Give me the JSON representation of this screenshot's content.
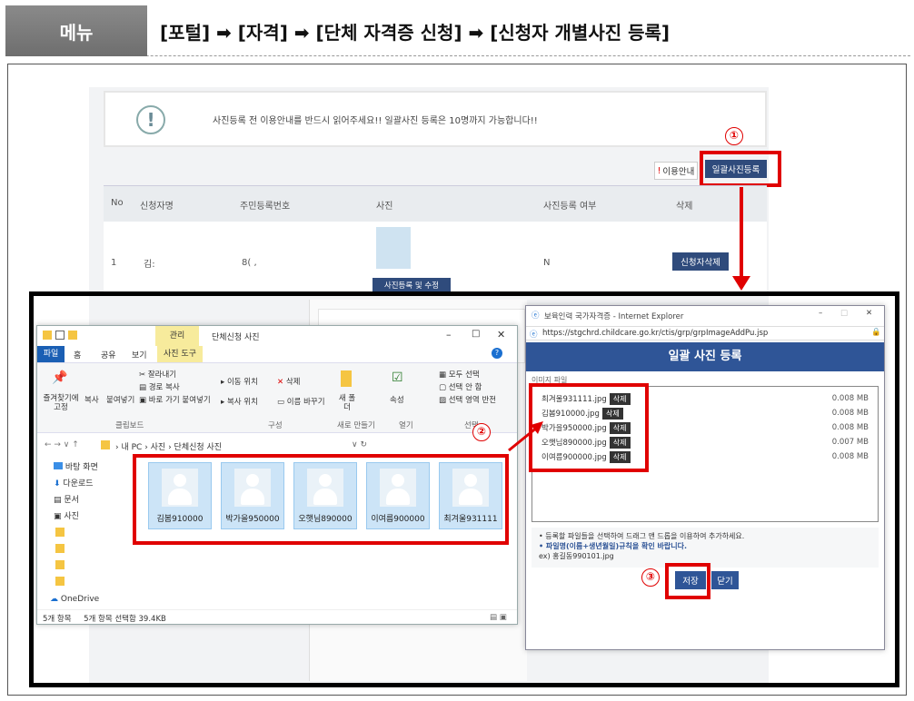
{
  "header": {
    "menu_label": "메뉴",
    "breadcrumb": "[포털] ➡ [자격] ➡ [단체 자격증 신청] ➡ [신청자 개별사진 등록]"
  },
  "webpage": {
    "notice_icon": "exclamation-icon",
    "notice_text": "사진등록 전 이용안내를 반드시 읽어주세요!! 일괄사진 등록은 10명까지 가능합니다!!",
    "guide_button": "이용안내",
    "bulk_upload_button": "일괄사진등록",
    "table": {
      "headers": [
        "No",
        "신청자명",
        "주민등록번호",
        "사진",
        "사진등록 여부",
        "삭제"
      ],
      "rows": [
        {
          "no": "1",
          "name": "김:",
          "rrn": "8(  ,",
          "photo_button": "사진등록 및 수정",
          "registered": "N",
          "delete_button": "신청자삭제"
        }
      ]
    }
  },
  "markers": {
    "step1": "①",
    "step2": "②",
    "step3": "③"
  },
  "explorer": {
    "quick_access_label": "관리",
    "window_title": "단체신청 사진",
    "tabs": [
      "파일",
      "홈",
      "공유",
      "보기",
      "사진 도구"
    ],
    "ribbon": {
      "pin": "즐겨찾기에 고정",
      "copy": "복사",
      "paste": "붙여넣기",
      "cut": "잘라내기",
      "copy_path": "경로 복사",
      "paste_shortcut": "바로 가기 붙여넣기",
      "clipboard_group": "클립보드",
      "move_to": "이동 위치",
      "delete": "삭제",
      "copy_to": "복사 위치",
      "rename": "이름 바꾸기",
      "organize_group": "구성",
      "new_folder": "새 폴더",
      "new_group": "새로 만들기",
      "properties": "속성",
      "open_group": "열기",
      "select_all": "모두 선택",
      "select_none": "선택 안 함",
      "invert_select": "선택 영역 반전",
      "select_group": "선택"
    },
    "address": [
      "내 PC",
      "사진",
      "단체신청 사진"
    ],
    "sidebar": [
      "바탕 화면",
      "다운로드",
      "문서",
      "사진",
      "OneDrive"
    ],
    "files": [
      "김봄910000",
      "박가을950000",
      "오햇님890000",
      "이여름900000",
      "최겨울931111"
    ],
    "status": "5개 항목     5개 항목 선택함 39.4KB"
  },
  "ie": {
    "title": "보육인력 국가자격증 - Internet Explorer",
    "url": "https://stgchrd.childcare.go.kr/ctis/grp/grpImageAddPu.jsp",
    "banner": "일괄 사진 등록",
    "list_label": "이미지 파일",
    "delete_chip": "삭제",
    "files": [
      {
        "name": "최겨울931111.jpg",
        "size": "0.008 MB"
      },
      {
        "name": "김봄910000.jpg",
        "size": "0.008 MB"
      },
      {
        "name": "박가을950000.jpg",
        "size": "0.008 MB"
      },
      {
        "name": "오햇님890000.jpg",
        "size": "0.007 MB"
      },
      {
        "name": "이여름900000.jpg",
        "size": "0.008 MB"
      }
    ],
    "note1": "• 등록할 파일들을 선택하여 드래그 앤 드롭을 이용하여 추가하세요.",
    "note2": "• 파일명(이름+생년월일)규칙을 확인 바랍니다.",
    "note3": "ex) 홍길동990101.jpg",
    "save_button": "저장",
    "close_button": "닫기"
  },
  "colors": {
    "accent_red": "#e00000",
    "brand_blue": "#2f5597"
  }
}
